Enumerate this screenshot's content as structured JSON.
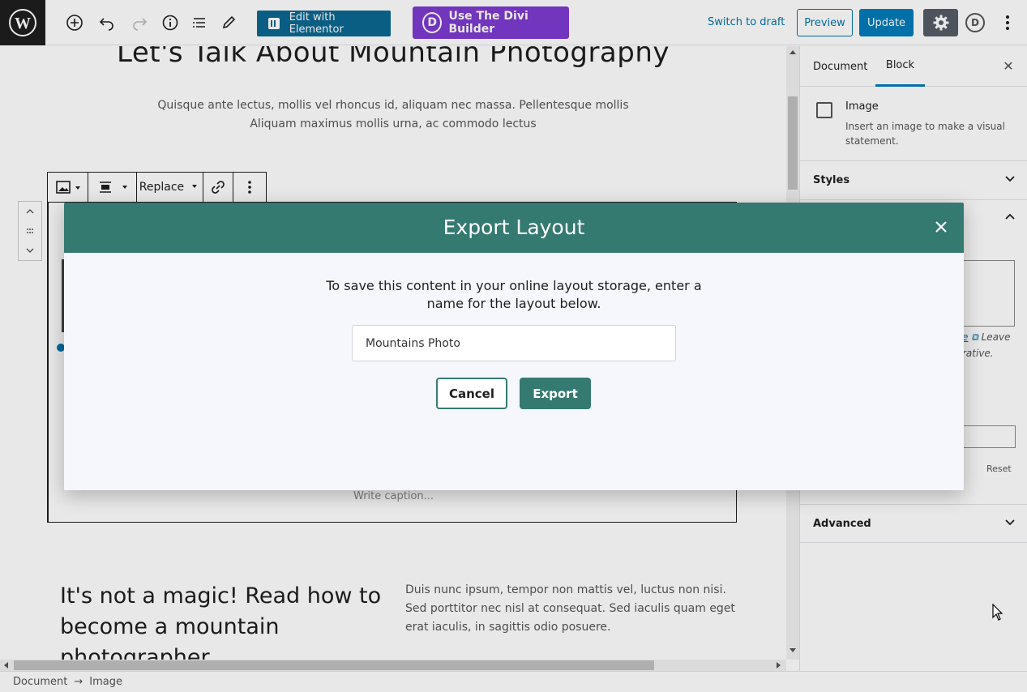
{
  "topbar": {
    "elementor_label": "Edit with Elementor",
    "divi_letter": "D",
    "divi_label": "Use The Divi Builder",
    "switch_draft": "Switch to draft",
    "preview": "Preview",
    "update": "Update",
    "avatar_letter": "D"
  },
  "editor": {
    "title": "Let's Talk About Mountain Photography",
    "subtitle_line1": "Quisque ante lectus, mollis vel rhoncus id, aliquam nec massa. Pellentesque mollis",
    "subtitle_line2": "Aliquam maximus mollis urna, ac commodo lectus",
    "toolbar_replace": "Replace",
    "caption_placeholder": "Write caption...",
    "heading": "It's not a magic! Read how to become a mountain photographer",
    "paragraph": "Duis nunc ipsum, tempor non mattis vel, luctus non nisi. Sed porttitor nec nisl at consequat. Sed iaculis quam eget erat iaculis, in sagittis odio posuere."
  },
  "sidebar": {
    "tab_document": "Document",
    "tab_block": "Block",
    "block_title": "Image",
    "block_desc": "Insert an image to make a visual statement.",
    "styles": "Styles",
    "advanced": "Advanced",
    "frag_link": "e",
    "frag_leave": "Leave",
    "frag_rative": "rative.",
    "reset": "Reset"
  },
  "statusbar": {
    "crumb1": "Document",
    "arrow": "→",
    "crumb2": "Image"
  },
  "modal": {
    "title": "Export Layout",
    "description": "To save this content in your online layout storage, enter a name for the layout below.",
    "input_value": "Mountains Photo",
    "cancel": "Cancel",
    "export": "Export"
  },
  "colors": {
    "modal_accent": "#357a71",
    "divi_purple": "#7e3bd0",
    "elementor_blue": "#0d6890",
    "wp_blue": "#007cba"
  }
}
